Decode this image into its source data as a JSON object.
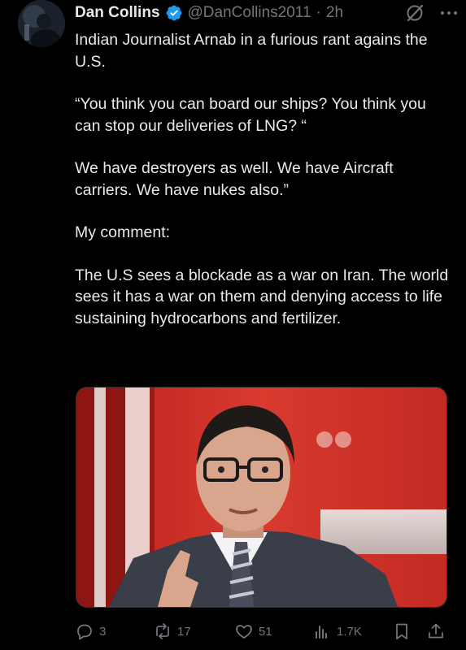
{
  "post": {
    "author": {
      "display_name": "Dan Collins",
      "handle": "@DanCollins2011",
      "separator": "·",
      "time": "2h",
      "verified": true,
      "verified_color": "#1d9bf0"
    },
    "paragraphs": [
      "Indian Journalist Arnab in a furious rant agains the U.S.",
      "“You think you can board our ships? You think you can stop our deliveries of LNG? “",
      "We have destroyers as well. We have Aircraft carriers. We have nukes also.”",
      "My comment:",
      "The U.S sees a blockade as a war on Iran. The world sees it has a war on them and denying access to life sustaining hydrocarbons and fertilizer."
    ],
    "media": {
      "type": "image",
      "subject": "man in glasses and suit on red news studio background"
    },
    "actions": {
      "replies": "3",
      "reposts": "17",
      "likes": "51",
      "views": "1.7K"
    },
    "icons": {
      "grok": "slash-circle-icon",
      "more": "more-dots-icon",
      "reply": "reply-icon",
      "repost": "repost-icon",
      "like": "heart-icon",
      "views": "views-chart-icon",
      "bookmark": "bookmark-icon",
      "share": "share-icon"
    }
  },
  "colors": {
    "background": "#000000",
    "text": "#e7e9ea",
    "secondary": "#71767b",
    "accent": "#1d9bf0"
  }
}
